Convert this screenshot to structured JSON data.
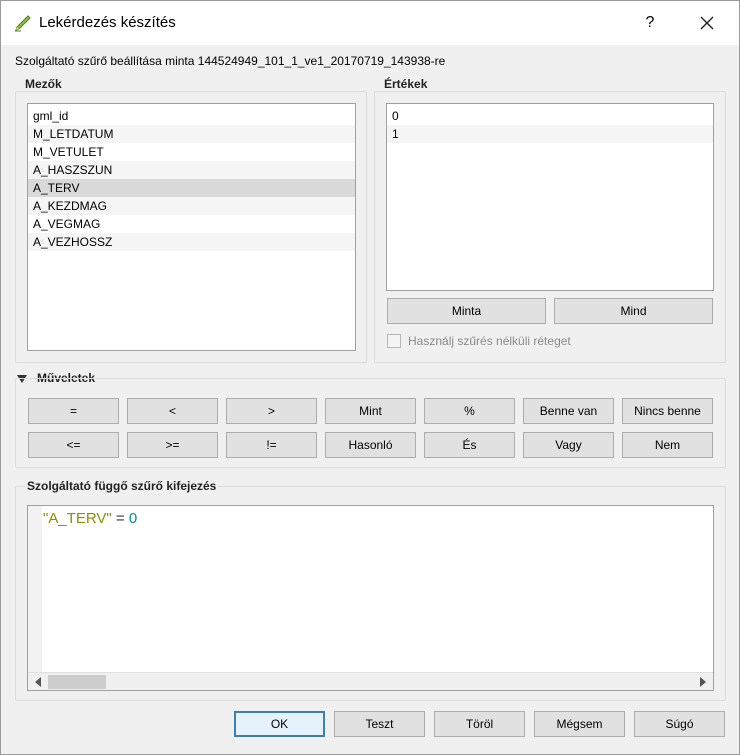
{
  "window": {
    "title": "Lekérdezés készítés",
    "help_label": "?",
    "close_icon": "close-icon",
    "app_icon": "qgis-pencil-icon"
  },
  "subtitle": "Szolgáltató szűrő beállítása minta 144524949_101_1_ve1_20170719_143938-re",
  "fields": {
    "title": "Mezők",
    "items": [
      "gml_id",
      "M_LETDATUM",
      "M_VETULET",
      "A_HASZSZUN",
      "A_TERV",
      "A_KEZDMAG",
      "A_VEGMAG",
      "A_VEZHOSSZ"
    ],
    "selected": "A_TERV"
  },
  "values": {
    "title": "Értékek",
    "items": [
      "0",
      "1"
    ],
    "sample_button": "Minta",
    "all_button": "Mind",
    "checkbox_label": "Használj szűrés nélküli réteget",
    "checkbox_checked": false
  },
  "operators": {
    "title": "Műveletek",
    "row1": [
      "=",
      "<",
      ">",
      "Mint",
      "%",
      "Benne van",
      "Nincs benne"
    ],
    "row2": [
      "<=",
      ">=",
      "!=",
      "Hasonló",
      "És",
      "Vagy",
      "Nem"
    ]
  },
  "expression": {
    "title": "Szolgáltató függő szűrő kifejezés",
    "field": "\"A_TERV\"",
    "operator": "=",
    "value": "0"
  },
  "footer": {
    "ok": "OK",
    "test": "Teszt",
    "clear": "Töröl",
    "cancel": "Mégsem",
    "help": "Súgó"
  },
  "colors": {
    "string_token": "#8e8e00",
    "number_token": "#009090",
    "default_button_border": "#3c7fb1"
  }
}
